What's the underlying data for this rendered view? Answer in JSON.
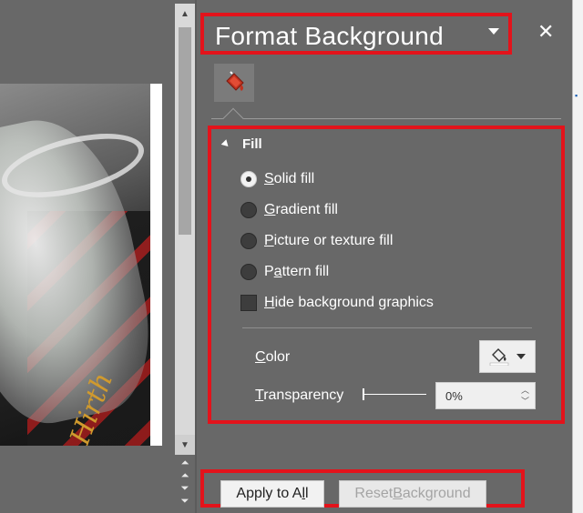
{
  "pane": {
    "title": "Format Background",
    "close_glyph": "✕",
    "tab_icon": "paint-bucket-icon"
  },
  "fill": {
    "header": "Fill",
    "options": [
      {
        "prefix": "",
        "accel": "S",
        "rest": "olid fill",
        "selected": true
      },
      {
        "prefix": "",
        "accel": "G",
        "rest": "radient fill",
        "selected": false
      },
      {
        "prefix": "",
        "accel": "P",
        "rest": "icture or texture fill",
        "selected": false
      },
      {
        "prefix": "P",
        "accel": "a",
        "rest": "ttern fill",
        "selected": false
      }
    ],
    "hide_graphics": {
      "accel": "H",
      "rest": "ide background graphics",
      "checked": false
    },
    "color_label": {
      "accel": "C",
      "rest": "olor"
    },
    "transparency_label": {
      "accel": "T",
      "rest": "ransparency"
    },
    "transparency_value": "0%"
  },
  "buttons": {
    "apply_all": {
      "prefix": "Apply to A",
      "accel": "l",
      "rest": "l"
    },
    "reset": {
      "prefix": "Reset ",
      "accel": "B",
      "rest": "ackground"
    }
  },
  "slide": {
    "photo_text": "Hirth"
  },
  "colors": {
    "highlight_border": "#e3131b",
    "pane_background": "#686868",
    "fill_icon_red": "#c0321f"
  }
}
